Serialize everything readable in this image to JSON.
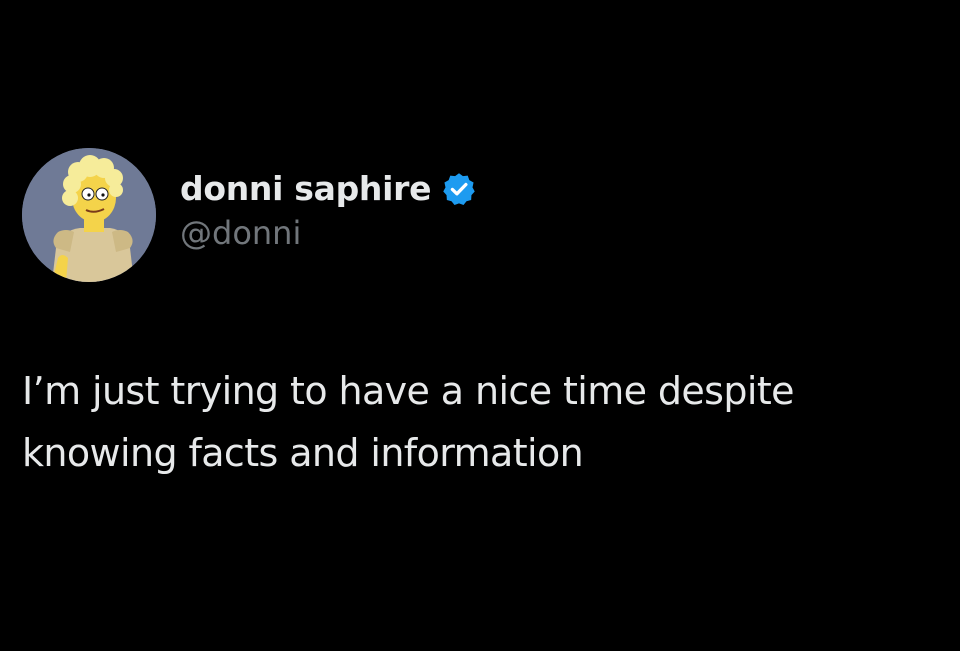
{
  "tweet": {
    "author": {
      "display_name": "donni saphire",
      "handle": "@donni",
      "verified": true,
      "avatar_icon": "cartoon-avatar-icon",
      "verified_icon": "verified-badge-icon",
      "verified_color": "#1d9bf0"
    },
    "text": "I’m just trying to have a nice time despite\nknowing facts and information"
  },
  "theme": {
    "background": "#000000",
    "text_color": "#e7e9ea",
    "secondary_text_color": "#71767b"
  }
}
